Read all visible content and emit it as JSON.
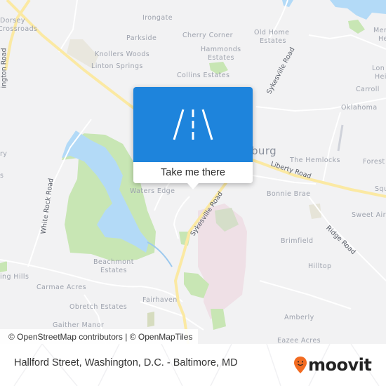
{
  "map": {
    "places": [
      {
        "name": "Dorsey",
        "id": "dorsey"
      },
      {
        "name": "Crossroads",
        "id": "crossroads"
      },
      {
        "name": "Irongate",
        "id": "irongate"
      },
      {
        "name": "Parkside",
        "id": "parkside"
      },
      {
        "name": "Cherry Corner",
        "id": "cherry-corner"
      },
      {
        "name": "Old Home",
        "id": "old-home"
      },
      {
        "name": "Estates",
        "id": "old-home-estates"
      },
      {
        "name": "Hammonds",
        "id": "hammonds"
      },
      {
        "name": "Estates",
        "id": "hammonds-estates"
      },
      {
        "name": "Knollers Woods",
        "id": "knollers-woods"
      },
      {
        "name": "Linton Springs",
        "id": "linton-springs"
      },
      {
        "name": "Collins Estates",
        "id": "collins-estates"
      },
      {
        "name": "Mer",
        "id": "mer"
      },
      {
        "name": "He",
        "id": "he"
      },
      {
        "name": "Lon",
        "id": "lon"
      },
      {
        "name": "Hei",
        "id": "hei"
      },
      {
        "name": "Carroll",
        "id": "carroll"
      },
      {
        "name": "Oklahoma",
        "id": "oklahoma"
      },
      {
        "name": "ry",
        "id": "ry"
      },
      {
        "name": "s",
        "id": "s"
      },
      {
        "name": "burg",
        "id": "burg"
      },
      {
        "name": "The Hemlocks",
        "id": "the-hemlocks"
      },
      {
        "name": "Forest",
        "id": "forest"
      },
      {
        "name": "Squ",
        "id": "squ"
      },
      {
        "name": "Waters Edge",
        "id": "waters-edge"
      },
      {
        "name": "Bonnie Brae",
        "id": "bonnie-brae"
      },
      {
        "name": "Sweet Air",
        "id": "sweet-air"
      },
      {
        "name": "Brimfield",
        "id": "brimfield"
      },
      {
        "name": "Beachmont",
        "id": "beachmont"
      },
      {
        "name": "Estates",
        "id": "beachmont-estates"
      },
      {
        "name": "ing Hills",
        "id": "ing-hills"
      },
      {
        "name": "Hilltop",
        "id": "hilltop"
      },
      {
        "name": "Carmae Acres",
        "id": "carmae-acres"
      },
      {
        "name": "Obretch Estates",
        "id": "obretch-estates"
      },
      {
        "name": "Fairhaven",
        "id": "fairhaven"
      },
      {
        "name": "Gaither Manor",
        "id": "gaither-manor"
      },
      {
        "name": "Amberly",
        "id": "amberly"
      },
      {
        "name": "Eazee Acres",
        "id": "eazee-acres"
      }
    ],
    "roads": [
      {
        "name": "Sykesville Road",
        "id": "sykesville-road-north"
      },
      {
        "name": "Liberty Road",
        "id": "liberty-road"
      },
      {
        "name": "White Rock Road",
        "id": "white-rock-road"
      },
      {
        "name": "Sykesville Road",
        "id": "sykesville-road-south"
      },
      {
        "name": "Ridge Road",
        "id": "ridge-road"
      },
      {
        "name": "ington Road",
        "id": "ington-road"
      }
    ],
    "colors": {
      "background": "#f2f2f3",
      "water": "#b3daf7",
      "park": "#c8e6b4",
      "major_road": "#fbe9a3",
      "residential": "#efe0e6"
    }
  },
  "popup": {
    "icon": "road-icon",
    "action_label": "Take me there",
    "accent_color": "#1e84dc"
  },
  "attribution": {
    "text": "© OpenStreetMap contributors | © OpenMapTiles"
  },
  "footer": {
    "title": "Hallford Street, Washington, D.C. - Baltimore, MD",
    "logo_text": "moovit",
    "logo_icon": "moovit-pin-icon",
    "logo_color": "#f26b21"
  }
}
